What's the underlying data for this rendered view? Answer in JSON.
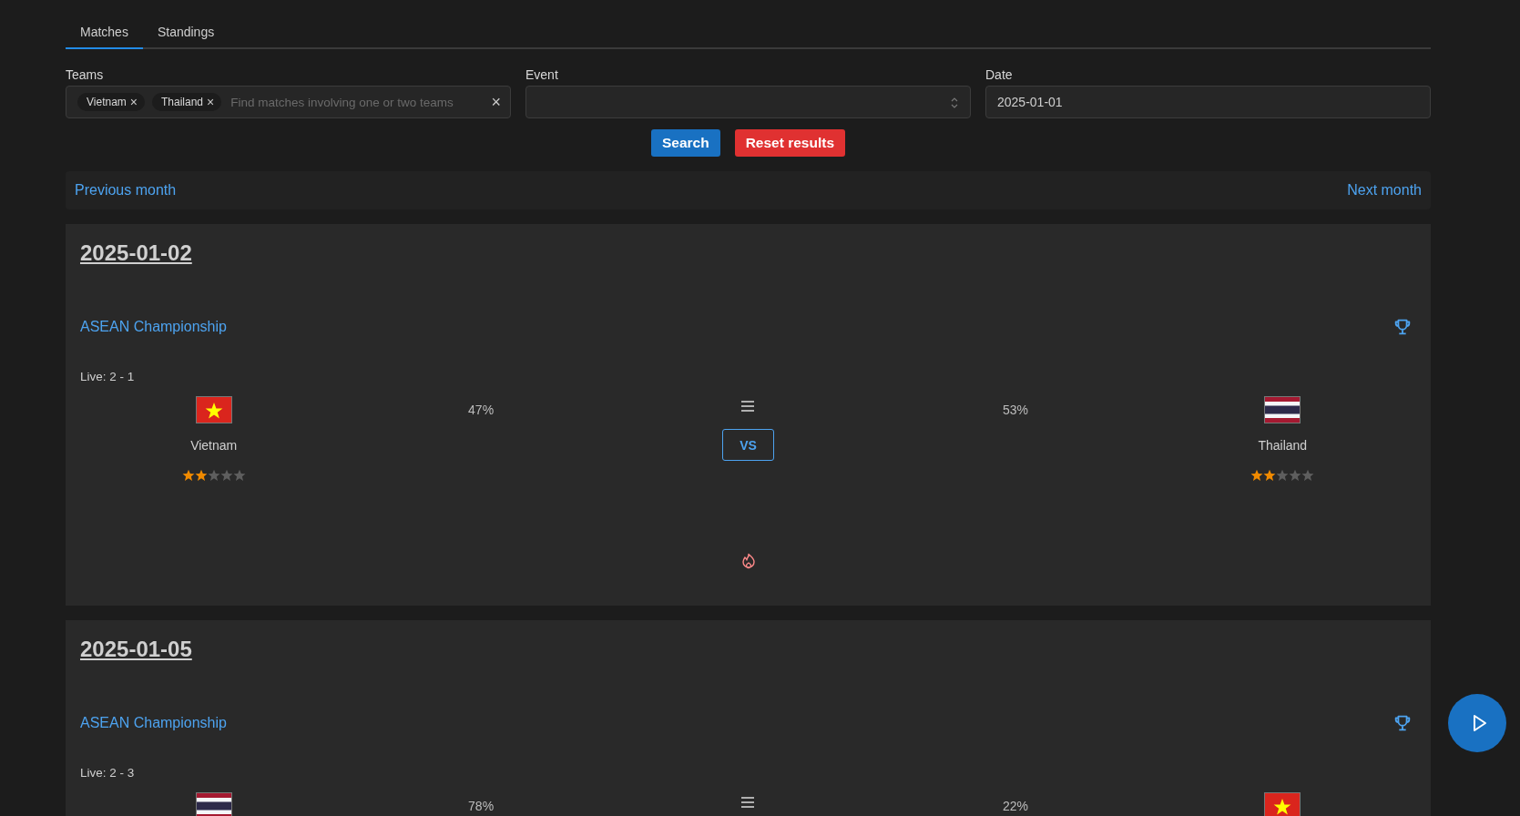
{
  "tabs": [
    {
      "label": "Matches",
      "selected": true
    },
    {
      "label": "Standings",
      "selected": false
    }
  ],
  "filters": {
    "teams": {
      "label": "Teams",
      "chips": [
        "Vietnam",
        "Thailand"
      ],
      "chip_remove": "×",
      "placeholder": "Find matches involving one or two teams",
      "clear": "×"
    },
    "event": {
      "label": "Event"
    },
    "date": {
      "label": "Date",
      "value": "2025-01-01"
    }
  },
  "buttons": [
    {
      "label": "Search",
      "kind": "primary"
    },
    {
      "label": "Reset results",
      "kind": "danger"
    }
  ],
  "month_nav": {
    "previous": "Previous month",
    "next": "Next month"
  },
  "matches": [
    {
      "date": "2025-01-02",
      "event": "ASEAN Championship",
      "live": "Live: 2 - 1",
      "vs": "VS",
      "home": {
        "name": "Vietnam",
        "kind": "vietnam",
        "stars": 2,
        "share": "47%"
      },
      "away": {
        "name": "Thailand",
        "kind": "thailand",
        "stars": 2,
        "share": "53%"
      },
      "hot": true
    },
    {
      "date": "2025-01-05",
      "event": "ASEAN Championship",
      "live": "Live: 2 - 3",
      "home": {
        "kind": "thailand",
        "share": "78%"
      },
      "away": {
        "kind": "vietnam",
        "share": "22%"
      }
    }
  ]
}
